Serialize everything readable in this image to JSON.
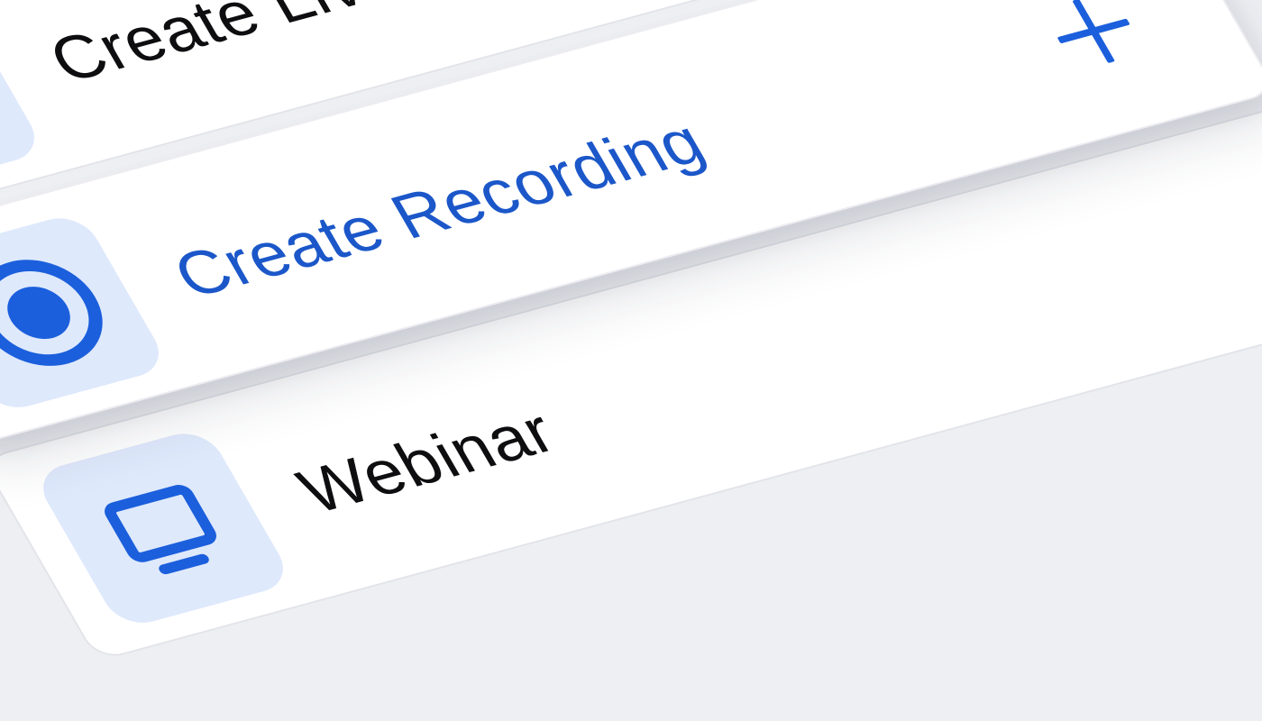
{
  "menu": {
    "items": [
      {
        "label": "Create Live stream",
        "icon": "live-stream-icon",
        "active": false
      },
      {
        "label": "Create Recording",
        "icon": "record-icon",
        "active": true,
        "action_icon": "plus-icon"
      },
      {
        "label": "Webinar",
        "icon": "webinar-icon",
        "active": false
      }
    ]
  },
  "colors": {
    "background": "#eeeff3",
    "card": "#ffffff",
    "accent": "#1b5fdc",
    "accent_text": "#1b57c9",
    "icon_tile": "#dfe9fc",
    "text": "#0e0e10"
  }
}
